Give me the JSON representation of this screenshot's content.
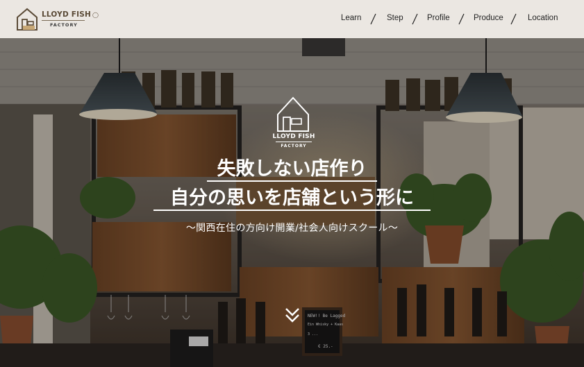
{
  "header": {
    "logo": {
      "main": "LLOYD FISH",
      "sub": "FACTORY",
      "mark": "fish-icon"
    },
    "nav": [
      {
        "label": "Learn"
      },
      {
        "label": "Step"
      },
      {
        "label": "Profile"
      },
      {
        "label": "Produce"
      },
      {
        "label": "Location"
      }
    ]
  },
  "hero": {
    "logo": {
      "main": "LLOYD FISH",
      "sub": "FACTORY"
    },
    "title_line1": "失敗しない店作り",
    "title_line2": "自分の思いを店舗という形に",
    "subtitle": "～関西在住の方向け開業/社会人向けスクール～",
    "chalkboard": {
      "line1": "NEW!! Be Lagged",
      "line2": "Ein Whisky + Kaas",
      "line3": "3 ...",
      "price": "€ 25.-"
    },
    "scroll_icon": "double-chevron-down-icon"
  },
  "colors": {
    "header_bg": "#ebe7e2",
    "logo_brown": "#5a4a36",
    "hero_text": "#ffffff"
  }
}
